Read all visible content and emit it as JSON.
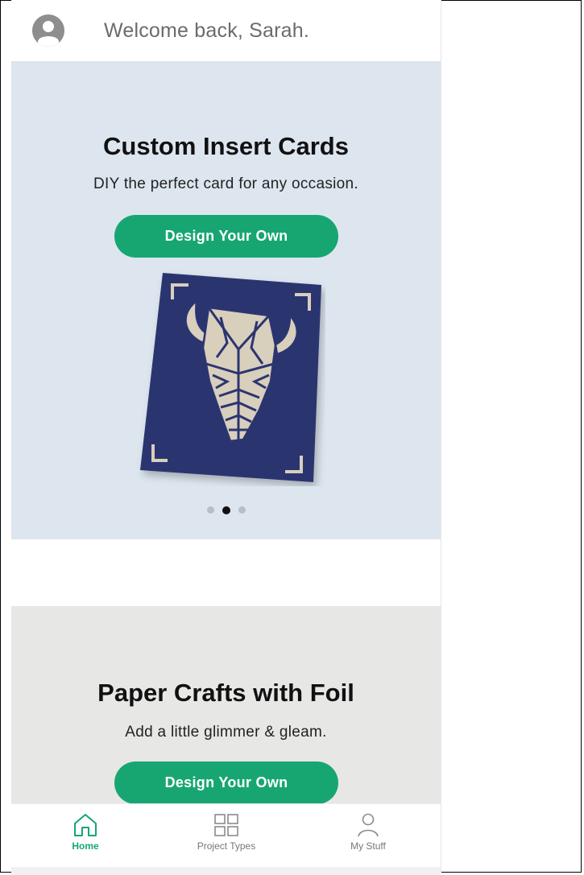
{
  "header": {
    "welcome_text": "Welcome back, Sarah."
  },
  "hero": {
    "title": "Custom Insert Cards",
    "subtitle": "DIY the perfect card for any occasion.",
    "cta_label": "Design Your Own",
    "carousel": {
      "total": 3,
      "active_index": 1
    }
  },
  "promo2": {
    "title": "Paper Crafts with Foil",
    "subtitle": "Add a little glimmer & gleam.",
    "cta_label": "Design Your Own"
  },
  "bottom_nav": {
    "items": [
      {
        "label": "Home",
        "icon": "home-icon",
        "active": true
      },
      {
        "label": "Project Types",
        "icon": "grid-icon",
        "active": false
      },
      {
        "label": "My Stuff",
        "icon": "user-icon",
        "active": false
      }
    ]
  },
  "colors": {
    "accent": "#17a672",
    "hero_bg": "#dde6ef",
    "promo2_bg": "#e7e7e6",
    "card_navy": "#2c3570",
    "card_cream": "#d8cfbd"
  }
}
